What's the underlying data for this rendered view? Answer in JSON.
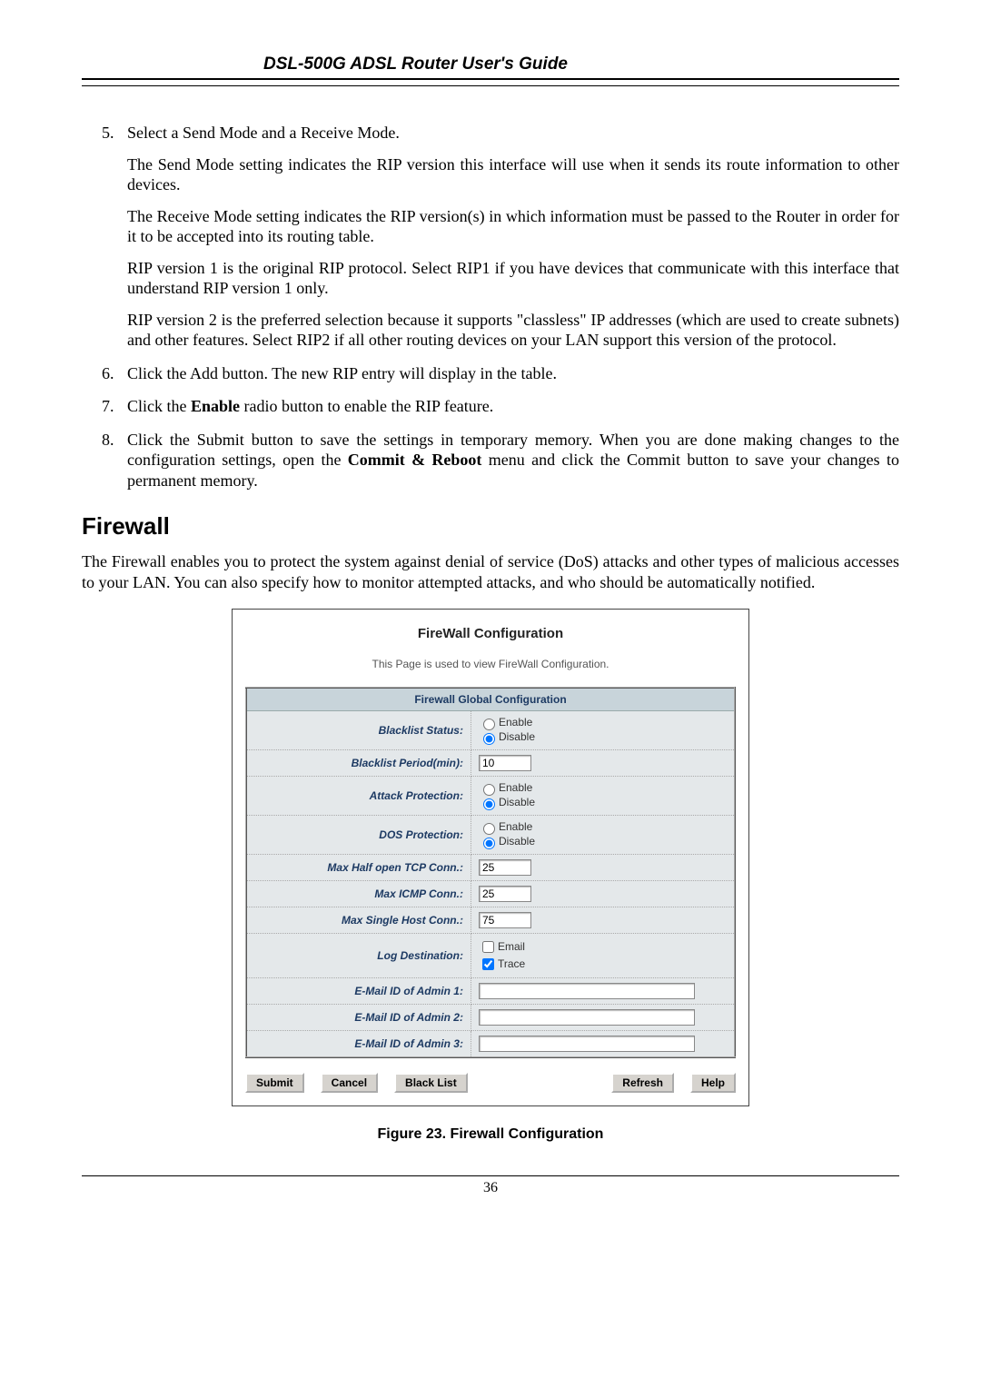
{
  "header": {
    "title": "DSL-500G ADSL Router User's Guide"
  },
  "list": {
    "item5_intro": "Select a Send Mode and a Receive Mode.",
    "item5_p1": "The Send Mode setting indicates the RIP version this interface will use when it sends its route information to other devices.",
    "item5_p2": "The Receive Mode setting indicates the RIP version(s) in which information must be passed to the Router in order for it to be accepted into its routing table.",
    "item5_p3": "RIP version 1 is the original RIP protocol. Select RIP1 if you have devices that communicate with this interface that understand RIP version 1 only.",
    "item5_p4": "RIP version 2 is the preferred selection because it supports \"classless\" IP addresses (which are used to create subnets) and other features. Select RIP2 if all other routing devices on your LAN support this version of the protocol.",
    "item6": "Click the Add button. The new RIP entry will display in the table.",
    "item7_a": "Click the ",
    "item7_b": "Enable",
    "item7_c": " radio button to enable the RIP feature.",
    "item8_a": "Click the Submit button to save the settings in temporary memory. When you are done making changes to the configuration settings, open the ",
    "item8_b": "Commit & Reboot",
    "item8_c": " menu and click the Commit button to save your changes to permanent memory."
  },
  "section": {
    "heading": "Firewall",
    "para": "The Firewall enables you to protect the system against denial of service (DoS) attacks and other types of malicious accesses to your LAN. You can also specify how to monitor attempted attacks, and who should be automatically notified."
  },
  "fw": {
    "title": "FireWall Configuration",
    "desc": "This Page is used to view FireWall Configuration.",
    "table_header": "Firewall Global Configuration",
    "rows": {
      "blacklist_status": "Blacklist Status:",
      "blacklist_period": "Blacklist Period(min):",
      "attack_protection": "Attack Protection:",
      "dos_protection": "DOS Protection:",
      "max_half_tcp": "Max Half open TCP Conn.:",
      "max_icmp": "Max ICMP Conn.:",
      "max_single_host": "Max Single Host Conn.:",
      "log_destination": "Log Destination:",
      "email1": "E-Mail ID of Admin 1:",
      "email2": "E-Mail ID of Admin 2:",
      "email3": "E-Mail ID of Admin 3:"
    },
    "radio": {
      "enable": "Enable",
      "disable": "Disable"
    },
    "cb": {
      "email": "Email",
      "trace": "Trace"
    },
    "values": {
      "blacklist_period": "10",
      "max_half_tcp": "25",
      "max_icmp": "25",
      "max_single_host": "75",
      "email1": "",
      "email2": "",
      "email3": ""
    },
    "buttons": {
      "submit": "Submit",
      "cancel": "Cancel",
      "blacklist": "Black List",
      "refresh": "Refresh",
      "help": "Help"
    }
  },
  "figure_caption": "Figure 23. Firewall Configuration",
  "footer_page": "36"
}
